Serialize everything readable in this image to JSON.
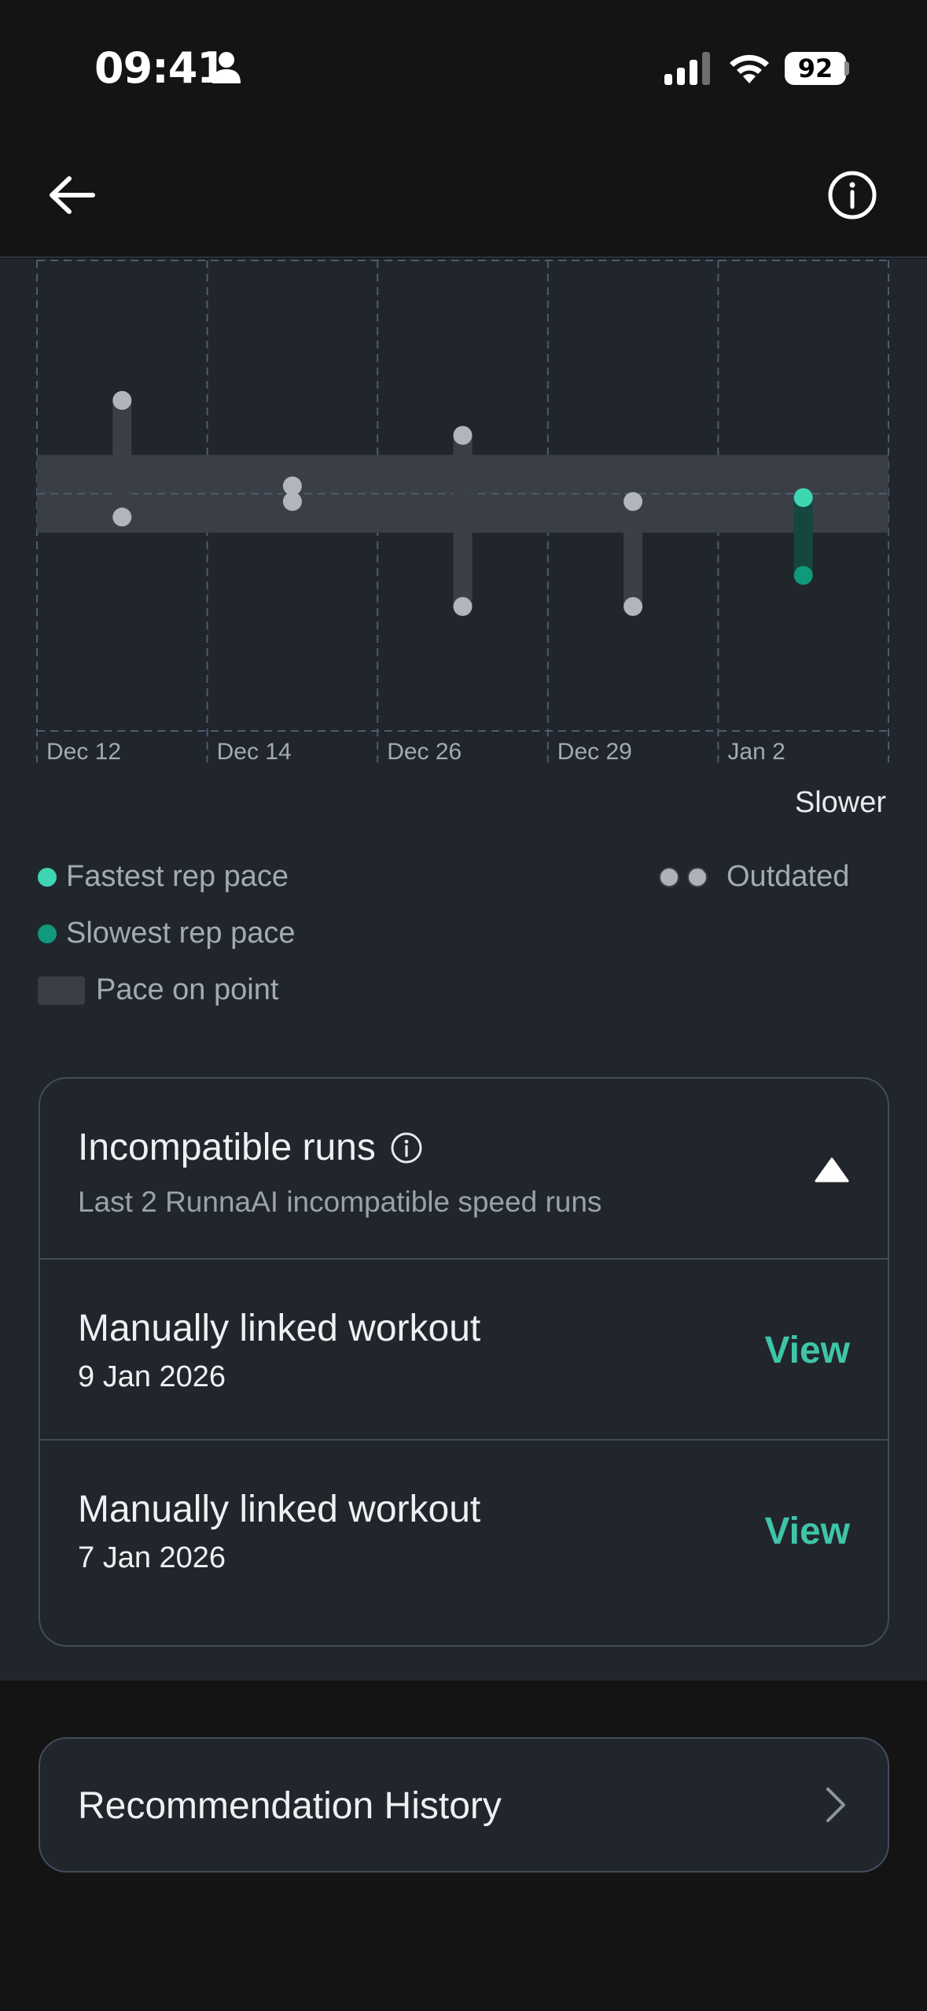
{
  "status_bar": {
    "time": "09:41",
    "battery": "92"
  },
  "header": {
    "back_icon": "arrow-left-icon",
    "info_icon": "info-icon"
  },
  "chart_data": {
    "type": "range",
    "categories": [
      "Dec 12",
      "Dec 14",
      "Dec 26",
      "Dec 29",
      "Jan 2"
    ],
    "series": [
      {
        "name": "Fastest rep pace",
        "values": [
          -2.4,
          -0.2,
          -1.5,
          0.2,
          0.1
        ]
      },
      {
        "name": "Slowest rep pace",
        "values": [
          0.6,
          0.2,
          2.9,
          2.9,
          2.1
        ]
      }
    ],
    "status": [
      "outdated",
      "outdated",
      "outdated",
      "outdated",
      "current"
    ],
    "pace_on_point_band": [
      -1,
      1
    ],
    "ylim": [
      -6,
      6.1
    ],
    "y_direction": "down = slower",
    "colors": {
      "fast": "#3fd5b3",
      "slow": "#10997a",
      "outdated": "#b1b6be",
      "band": "#3a3f46",
      "grid": "#4e5b70"
    }
  },
  "chart_labels": {
    "slower": "Slower"
  },
  "legend": {
    "fastest": "Fastest rep pace",
    "slowest": "Slowest rep pace",
    "on_point": "Pace on point",
    "outdated": "Outdated"
  },
  "incompatible": {
    "title": "Incompatible runs",
    "subtitle": "Last 2 RunnaAI incompatible speed runs",
    "runs": [
      {
        "title": "Manually linked workout",
        "date": "9 Jan 2026",
        "action": "View"
      },
      {
        "title": "Manually linked workout",
        "date": "7 Jan 2026",
        "action": "View"
      }
    ]
  },
  "recommendation": {
    "label": "Recommendation History"
  }
}
